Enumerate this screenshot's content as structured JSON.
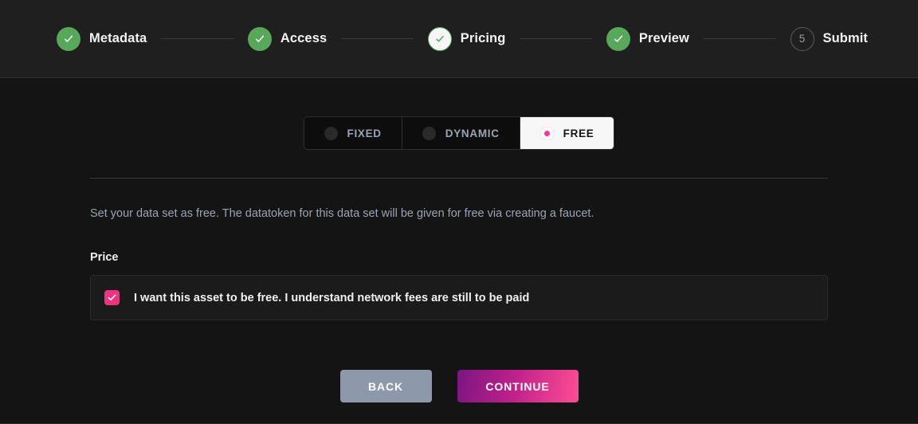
{
  "wizard": {
    "steps": [
      {
        "label": "Metadata",
        "state": "done",
        "marker": "check"
      },
      {
        "label": "Access",
        "state": "done",
        "marker": "check"
      },
      {
        "label": "Pricing",
        "state": "current",
        "marker": "check"
      },
      {
        "label": "Preview",
        "state": "done",
        "marker": "check"
      },
      {
        "label": "Submit",
        "state": "todo",
        "marker": "5"
      }
    ]
  },
  "pricing": {
    "tabs": [
      {
        "label": "FIXED",
        "active": false
      },
      {
        "label": "DYNAMIC",
        "active": false
      },
      {
        "label": "FREE",
        "active": true
      }
    ],
    "description": "Set your data set as free. The datatoken for this data set will be given for free via creating a faucet.",
    "price_heading": "Price",
    "free_checkbox": {
      "label": "I want this asset to be free. I understand network fees are still to be paid",
      "checked": true
    }
  },
  "actions": {
    "back_label": "BACK",
    "continue_label": "CONTINUE"
  },
  "colors": {
    "page_background": "#141414",
    "header_background": "#201f1f",
    "step_done": "#57a85a",
    "accent_pink": "#ff3399",
    "checkbox_pink": "#f5327f",
    "back_button": "#8d99aa",
    "continue_gradient_start": "#7b1580",
    "continue_gradient_end": "#ff4d94",
    "muted_text": "#9aa4b4"
  }
}
